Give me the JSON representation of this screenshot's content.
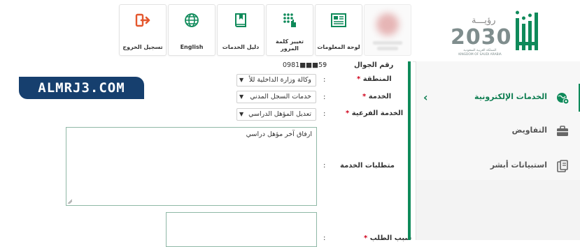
{
  "header": {
    "tiles": [
      {
        "label": "تسجيل الخروج",
        "icon": "logout-icon",
        "color": "#e4572e"
      },
      {
        "label": "English",
        "icon": "globe-icon",
        "color": "#0f8a5a"
      },
      {
        "label": "دليل الخدمات",
        "icon": "book-icon",
        "color": "#0f8a5a"
      },
      {
        "label": "تغيير كلمة المرور",
        "icon": "keypad-icon",
        "color": "#0f8a5a"
      },
      {
        "label": "لوحة المعلومات",
        "icon": "dashboard-icon",
        "color": "#0f8a5a"
      }
    ],
    "vision": {
      "arabic": "رؤيـــة",
      "year": "2030",
      "line1": "المملكة العربية السعودية",
      "line2": "KINGDOM OF SAUDI ARABIA"
    }
  },
  "form": {
    "mobile": {
      "label": "رقم الجوال",
      "value": "59■■■0981"
    },
    "region": {
      "label": "المنطقة",
      "value": "وكالة وزارة الداخلية للأ"
    },
    "service": {
      "label": "الخدمة",
      "value": "خدمات السجل المدني"
    },
    "sub_service": {
      "label": "الخدمة الفرعية",
      "value": "تعديل المؤهل الدراسي"
    },
    "requirements": {
      "label": "متطلبات الخدمة",
      "text": "ارفاق آخر مؤهل دراسي"
    },
    "next_label": "سبب الطلب"
  },
  "sidebar": {
    "items": [
      {
        "label": "الخدمات الإلكترونية",
        "icon": "globe-gear-icon",
        "active": true
      },
      {
        "label": "التفاويض",
        "icon": "briefcase-icon",
        "active": false
      },
      {
        "label": "استبيانات أبشر",
        "icon": "survey-icon",
        "active": false
      }
    ]
  },
  "watermark": "ALMRJ3.COM",
  "colors": {
    "primary": "#0f8a5a",
    "required": "#d0021b",
    "badge": "#163f6e"
  }
}
